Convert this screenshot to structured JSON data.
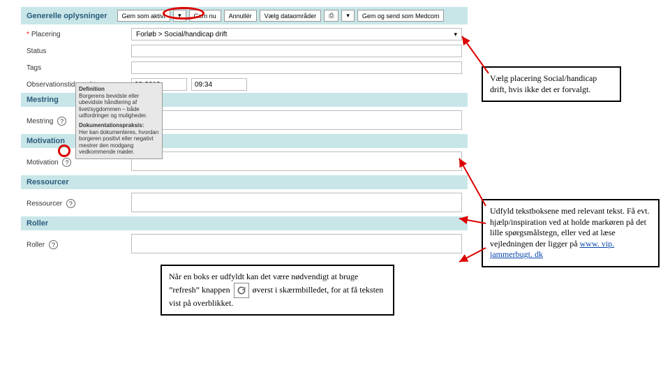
{
  "toolbar": {
    "gem_aktivt": "Gem som aktivt",
    "gem_nu": "Gem nu",
    "annuller": "Annullér",
    "vaelg_dataomraader": "Vælg dataområder",
    "print_icon_label": "⎙",
    "gem_medcom": "Gem og send som Medcom"
  },
  "sections": {
    "generelle": "Generelle oplysninger",
    "mestring": "Mestring",
    "motivation": "Motivation",
    "ressourcer": "Ressourcer",
    "roller": "Roller"
  },
  "rows": {
    "placering": {
      "label": "Placering",
      "value": "Forløb > Social/handicap drift"
    },
    "status": {
      "label": "Status",
      "value": ""
    },
    "tags": {
      "label": "Tags",
      "value": ""
    },
    "observation": {
      "label": "Observationstidspunkt",
      "date": "08-2019",
      "time": "09:34"
    },
    "mestring": {
      "label": "Mestring"
    },
    "motivation": {
      "label": "Motivation"
    },
    "ressourcer": {
      "label": "Ressourcer"
    },
    "roller": {
      "label": "Roller"
    }
  },
  "tooltip": {
    "title": "Definition",
    "body1": "Borgerens bevidste eller ubevidste håndtering af livet/sygdommen – både udfordringer og muligheder.",
    "title2": "Dokumentationspraksis:",
    "body2": "Her kan dokumenteres, hvordan borgeren positivt eller negativt mestrer den modgang vedkommende møder."
  },
  "annots": {
    "a1": "Vælg placering Social/handicap drift, hvis ikke det er forvalgt.",
    "a2_1": "Udfyld tekstboksene med relevant tekst. Få evt. hjælp/inspiration ved at holde markøren på det lille spørgsmålstegn, eller ved at læse vejledningen der ligger på ",
    "a2_link": "www. vip. jammerbugt. dk",
    "a3_1": "Når en boks er udfyldt kan det være nødvendigt at bruge ”refresh” knappen",
    "a3_2": "øverst i skærmbilledet,  for at få teksten vist på overblikket."
  },
  "help_symbol": "?",
  "caret": "▾"
}
